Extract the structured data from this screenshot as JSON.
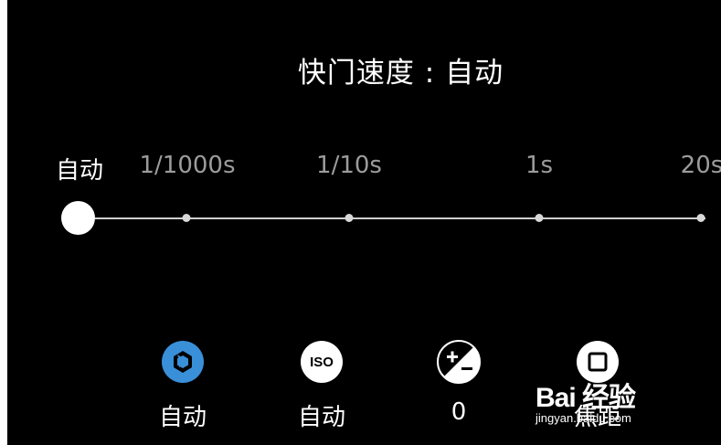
{
  "title": "快门速度 : 自动",
  "slider": {
    "labels": [
      "自动",
      "1/1000s",
      "1/10s",
      "1s",
      "20s"
    ],
    "selected_index": 0
  },
  "modes": [
    {
      "icon": "shutter-aperture-icon",
      "label": "自动",
      "color": "#3a8fd9"
    },
    {
      "icon": "iso-icon",
      "label": "自动",
      "text": "ISO"
    },
    {
      "icon": "exposure-compensation-icon",
      "label": "0"
    },
    {
      "icon": "focus-square-icon",
      "label": "焦距"
    }
  ],
  "watermark": {
    "brand": "Bai 经验",
    "url": "jingyan.baidu.com"
  }
}
